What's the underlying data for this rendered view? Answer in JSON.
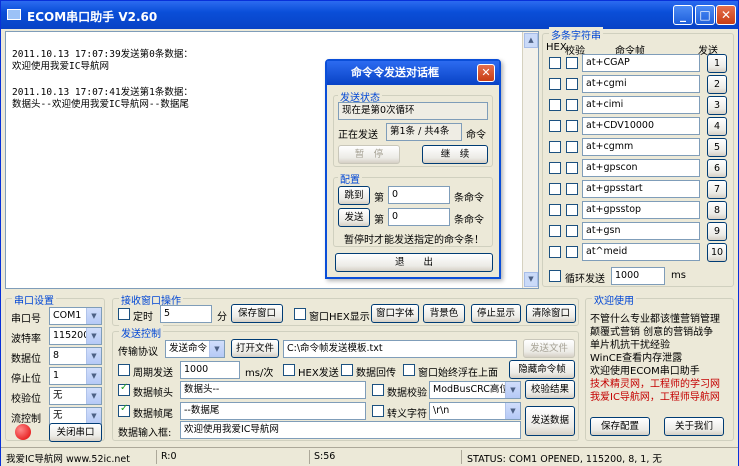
{
  "window": {
    "title": "ECOM串口助手  V2.60",
    "min_label": "_",
    "max_label": "□",
    "close_label": "✕"
  },
  "receive": {
    "lines": [
      "2011.10.13 17:07:39发送第0条数据：",
      "欢迎使用我爱IC导航网",
      "",
      "2011.10.13 17:07:41发送第1条数据：",
      "数据头--欢迎使用我爱IC导航网--数据尾"
    ]
  },
  "multi": {
    "title": "多条字符串",
    "col_hex": "HEX",
    "col_check": "校验",
    "col_cmd": "命令帧",
    "col_send": "发送",
    "rows": [
      {
        "cmd": "at+CGAP",
        "send": "1"
      },
      {
        "cmd": "at+cgmi",
        "send": "2"
      },
      {
        "cmd": "at+cimi",
        "send": "3"
      },
      {
        "cmd": "at+CDV10000",
        "send": "4"
      },
      {
        "cmd": "at+cgmm",
        "send": "5"
      },
      {
        "cmd": "at+gpscon",
        "send": "6"
      },
      {
        "cmd": "at+gpsstart",
        "send": "7"
      },
      {
        "cmd": "at+gpsstop",
        "send": "8"
      },
      {
        "cmd": "at+gsn",
        "send": "9"
      },
      {
        "cmd": "at^meid",
        "send": "10"
      }
    ],
    "loop_label": "循环发送",
    "loop_value": "1000",
    "loop_unit": "ms"
  },
  "dialog": {
    "title": "命令令发送对话框",
    "close_label": "✕",
    "status_group": "发送状态",
    "status_text": "现在是第0次循环",
    "sending_label": "正在发送",
    "sending_value": "第1条 / 共4条",
    "sending_unit": "命令",
    "pause_label": "暂　停",
    "continue_label": "继　续",
    "config_group": "配置",
    "jump_label": "跳到",
    "jump_prefix": "第",
    "jump_value": "0",
    "jump_unit": "条命令",
    "send_label": "发送",
    "send_prefix": "第",
    "send_value": "0",
    "send_unit": "条命令",
    "hint": "暂停时才能发送指定的命令条！",
    "exit_label": "退　　出"
  },
  "port": {
    "title": "串口设置",
    "port_label": "串口号",
    "port_value": "COM1",
    "baud_label": "波特率",
    "baud_value": "115200",
    "data_label": "数据位",
    "data_value": "8",
    "stop_label": "停止位",
    "stop_value": "1",
    "parity_label": "校验位",
    "parity_value": "无",
    "flow_label": "流控制",
    "flow_value": "无",
    "close_label": "关闭串口"
  },
  "recvops": {
    "title": "接收窗口操作",
    "timer_label": "定时",
    "timer_value": "5",
    "timer_unit": "分",
    "save_label": "保存窗口",
    "hex_label": "窗口HEX显示",
    "font_label": "窗口字体",
    "bg_label": "背景色",
    "stop_label": "停止显示",
    "clear_label": "清除窗口"
  },
  "sendctl": {
    "title": "发送控制",
    "proto_label": "传输协议",
    "proto_value": "发送命令",
    "open_label": "打开文件",
    "file_path": "C:\\命令帧发送模板.txt",
    "send_file_label": "发送文件",
    "period_label": "周期发送",
    "period_value": "1000",
    "period_unit": "ms/次",
    "hex_send_label": "HEX发送",
    "echo_label": "数据回传",
    "top_label": "窗口始终浮在上面",
    "hide_label": "隐藏命令帧",
    "head_label": "数据帧头",
    "head_value": "数据头--",
    "check_label": "数据校验",
    "check_value": "ModBusCRC高位在",
    "check_result": "校验结果",
    "tail_label": "数据帧尾",
    "tail_value": "--数据尾",
    "escape_label": "转义字符",
    "escape_value": "\\r\\n",
    "input_label": "数据输入框:",
    "input_value": "欢迎使用我爱IC导航网",
    "send_label": "发送数据"
  },
  "welcome": {
    "title": "欢迎使用",
    "lines": [
      "不管什么专业都该懂营销管理",
      "颠覆式营销 创意的营销战争",
      "单片机抗干扰经验",
      "WinCE查看内存泄露",
      "欢迎使用ECOM串口助手"
    ],
    "red_lines": [
      "技术精灵网，工程师的学习网",
      "我爱IC导航网，工程师导航网"
    ],
    "save_label": "保存配置",
    "about_label": "关于我们"
  },
  "statusbar": {
    "site": "我爱IC导航网  www.52ic.net",
    "r": "R:0",
    "s": "S:56",
    "status": "STATUS: COM1 OPENED, 115200, 8, 1, 无"
  }
}
